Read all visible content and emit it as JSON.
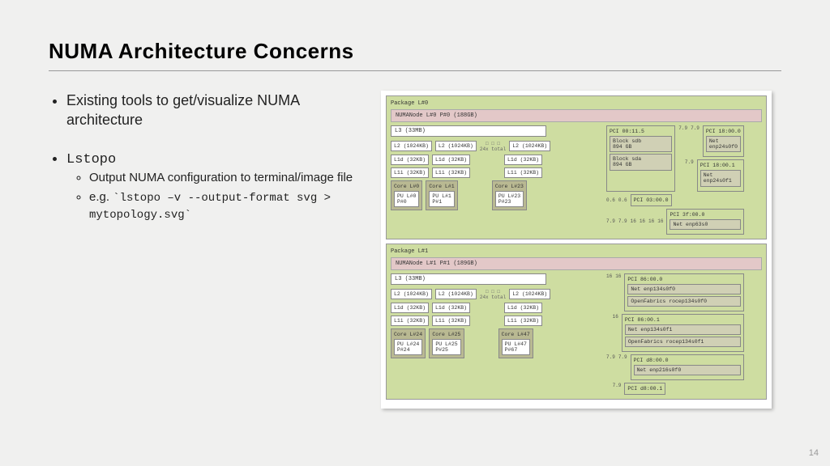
{
  "title": "NUMA Architecture Concerns",
  "page_number": "14",
  "bullets": {
    "b1": "Existing tools to get/visualize NUMA architecture",
    "b2": "Lstopo",
    "b2_1": "Output NUMA configuration to terminal/image file",
    "b2_2_prefix": "e.g. ",
    "b2_2_code": "`lstopo –v --output-format svg > mytopology.svg`"
  },
  "diagram": {
    "pkg0": {
      "label": "Package L#0",
      "numa": "NUMANode L#0 P#0 (188GB)",
      "l3": "L3 (33MB)",
      "l2": "L2 (1024KB)",
      "l1d": "L1d (32KB)",
      "l1i": "L1i (32KB)",
      "core0": "Core L#0",
      "pu0": "PU L#0\nP#0",
      "core1": "Core L#1",
      "pu1": "PU L#1\nP#1",
      "core23": "Core L#23",
      "pu23": "PU L#23\nP#23",
      "dots": "□ □ □\n24x total",
      "pci1": "PCI 00:11.5",
      "dev_sdb": "Block sdb\n894 GB",
      "dev_sda": "Block sda\n894 GB",
      "pci2": "PCI 18:00.0",
      "dev2": "Net enp24s0f0",
      "pci3": "PCI 18:00.1",
      "dev3": "Net enp24s0f1",
      "pci4": "PCI 03:00.0",
      "pci5": "PCI 3f:00.0",
      "dev5": "Net enp63s0",
      "link_79": "7.9",
      "link_06": "0.6",
      "link_16": "16"
    },
    "pkg1": {
      "label": "Package L#1",
      "numa": "NUMANode L#1 P#1 (189GB)",
      "l3": "L3 (33MB)",
      "l2": "L2 (1024KB)",
      "l1d": "L1d (32KB)",
      "l1i": "L1i (32KB)",
      "core24": "Core L#24",
      "pu24": "PU L#24\nP#24",
      "core25": "Core L#25",
      "pu25": "PU L#25\nP#25",
      "core47": "Core L#47",
      "pu47": "PU L#47\nP#67",
      "dots": "□ □ □\n24x total",
      "pci1": "PCI 86:00.0",
      "dev1a": "Net enp134s0f0",
      "dev1b": "OpenFabrics rocep134s0f0",
      "pci2": "PCI 86:00.1",
      "dev2a": "Net enp134s0f1",
      "dev2b": "OpenFabrics rocep134s0f1",
      "pci3": "PCI d8:00.0",
      "dev3": "Net enp216s0f0",
      "pci4": "PCI d8:00.1",
      "link_16": "16",
      "link_79": "7.9"
    }
  }
}
